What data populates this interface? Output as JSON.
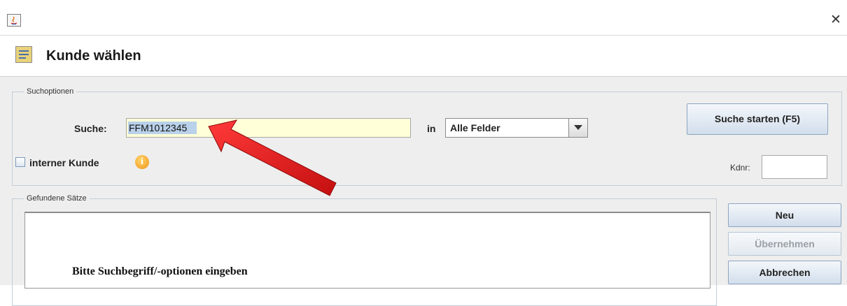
{
  "window": {
    "close_glyph": "✕"
  },
  "header": {
    "title": "Kunde wählen",
    "icon": "form-list-icon"
  },
  "search_options": {
    "legend": "Suchoptionen",
    "search_label": "Suche:",
    "search_value": "FFM1012345",
    "in_label": "in",
    "field_select_value": "Alle Felder",
    "internal_customer_label": "interner Kunde",
    "internal_customer_checked": false,
    "start_button": "Suche starten (F5)",
    "kdnr_label": "Kdnr:",
    "kdnr_value": ""
  },
  "results": {
    "legend": "Gefundene Sätze",
    "message": "Bitte Suchbegriff/-optionen eingeben"
  },
  "side_buttons": {
    "new": "Neu",
    "accept": "Übernehmen",
    "cancel": "Abbrechen"
  },
  "annotation": {
    "arrow_color": "#e01b1b"
  }
}
